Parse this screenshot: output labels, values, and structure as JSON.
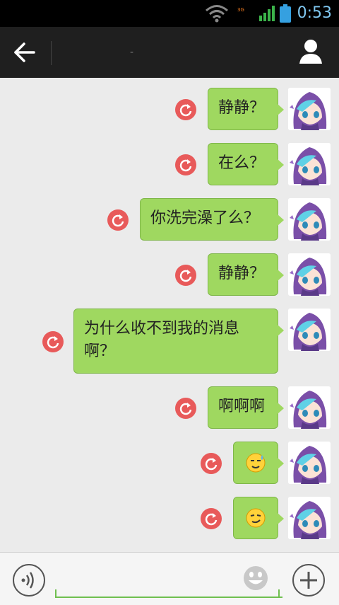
{
  "status_bar": {
    "time": "0:53",
    "network": "3G"
  },
  "title_bar": {
    "title": "-"
  },
  "messages": [
    {
      "text": "静静？"
    },
    {
      "text": "在么？"
    },
    {
      "text": "你洗完澡了么？"
    },
    {
      "text": "静静？"
    },
    {
      "text": "为什么收不到我的消息啊？"
    },
    {
      "text": "啊啊啊"
    },
    {
      "text": "",
      "emoji": "sweat-emoji"
    },
    {
      "text": "",
      "emoji": "smirk-emoji"
    }
  ],
  "input_bar": {
    "value": "",
    "placeholder": ""
  },
  "colors": {
    "bubble": "#9fd860",
    "retry": "#e85a5a",
    "titlebar": "#1f1f1f",
    "accent_underline": "#6fbf4f"
  }
}
